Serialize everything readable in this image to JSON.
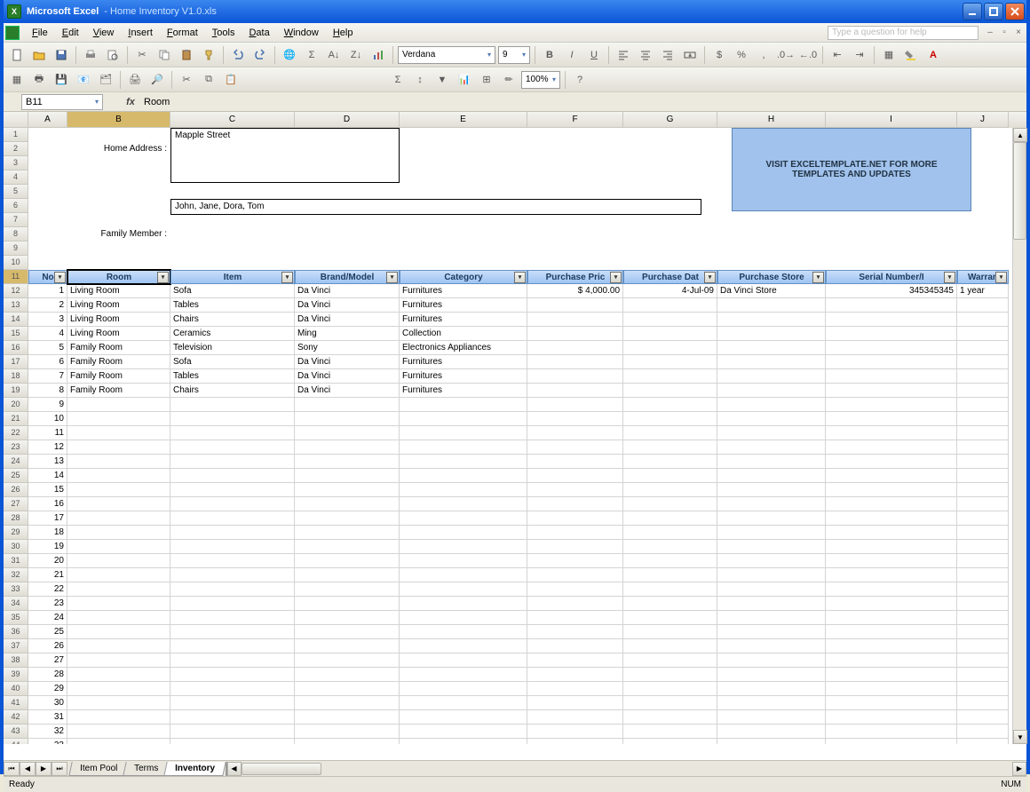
{
  "window": {
    "app": "Microsoft Excel",
    "doc": "Home Inventory V1.0.xls"
  },
  "menu": [
    "File",
    "Edit",
    "View",
    "Insert",
    "Format",
    "Tools",
    "Data",
    "Window",
    "Help"
  ],
  "askbox": "Type a question for help",
  "namebox": "B11",
  "formulaValue": "Room",
  "font": {
    "name": "Verdana",
    "size": "9"
  },
  "zoom": "100%",
  "columns": [
    {
      "letter": "A",
      "w": 44
    },
    {
      "letter": "B",
      "w": 116
    },
    {
      "letter": "C",
      "w": 140
    },
    {
      "letter": "D",
      "w": 118
    },
    {
      "letter": "E",
      "w": 144
    },
    {
      "letter": "F",
      "w": 108
    },
    {
      "letter": "G",
      "w": 106
    },
    {
      "letter": "H",
      "w": 122
    },
    {
      "letter": "I",
      "w": 148
    },
    {
      "letter": "J",
      "w": 58
    }
  ],
  "form": {
    "addressLabel": "Home Address :",
    "addressValue": "Mapple Street",
    "familyLabel": "Family Member :",
    "familyValue": "John, Jane, Dora, Tom"
  },
  "promo": "VISIT EXCELTEMPLATE.NET FOR MORE TEMPLATES AND UPDATES",
  "headers": [
    "No",
    "Room",
    "Item",
    "Brand/Model",
    "Category",
    "Purchase Pric",
    "Purchase Dat",
    "Purchase Store",
    "Serial Number/I",
    "Warran"
  ],
  "rows": [
    {
      "n": "1",
      "room": "Living Room",
      "item": "Sofa",
      "brand": "Da Vinci",
      "cat": "Furnitures",
      "price": "$       4,000.00",
      "date": "4-Jul-09",
      "store": "Da Vinci Store",
      "serial": "345345345",
      "war": "1 year"
    },
    {
      "n": "2",
      "room": "Living Room",
      "item": "Tables",
      "brand": "Da Vinci",
      "cat": "Furnitures",
      "price": "",
      "date": "",
      "store": "",
      "serial": "",
      "war": ""
    },
    {
      "n": "3",
      "room": "Living Room",
      "item": "Chairs",
      "brand": "Da Vinci",
      "cat": "Furnitures",
      "price": "",
      "date": "",
      "store": "",
      "serial": "",
      "war": ""
    },
    {
      "n": "4",
      "room": "Living Room",
      "item": "Ceramics",
      "brand": "Ming",
      "cat": "Collection",
      "price": "",
      "date": "",
      "store": "",
      "serial": "",
      "war": ""
    },
    {
      "n": "5",
      "room": "Family Room",
      "item": "Television",
      "brand": "Sony",
      "cat": "Electronics Appliances",
      "price": "",
      "date": "",
      "store": "",
      "serial": "",
      "war": ""
    },
    {
      "n": "6",
      "room": "Family Room",
      "item": "Sofa",
      "brand": "Da Vinci",
      "cat": "Furnitures",
      "price": "",
      "date": "",
      "store": "",
      "serial": "",
      "war": ""
    },
    {
      "n": "7",
      "room": "Family Room",
      "item": "Tables",
      "brand": "Da Vinci",
      "cat": "Furnitures",
      "price": "",
      "date": "",
      "store": "",
      "serial": "",
      "war": ""
    },
    {
      "n": "8",
      "room": "Family Room",
      "item": "Chairs",
      "brand": "Da Vinci",
      "cat": "Furnitures",
      "price": "",
      "date": "",
      "store": "",
      "serial": "",
      "war": ""
    }
  ],
  "emptyRowStart": 9,
  "sheetTabs": [
    "Item Pool",
    "Terms",
    "Inventory"
  ],
  "activeTab": "Inventory",
  "status": "Ready",
  "numlock": "NUM",
  "totalVisibleRows": 46
}
